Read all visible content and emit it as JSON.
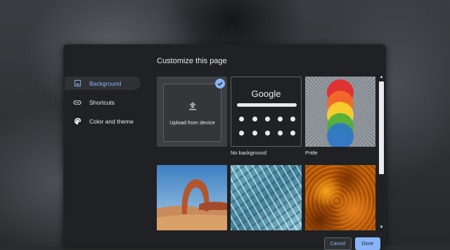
{
  "dialog": {
    "title": "Customize this page"
  },
  "nav": {
    "items": [
      {
        "label": "Background",
        "icon": "image-icon",
        "active": true
      },
      {
        "label": "Shortcuts",
        "icon": "link-icon",
        "active": false
      },
      {
        "label": "Color and theme",
        "icon": "palette-icon",
        "active": false
      }
    ]
  },
  "tiles": {
    "upload_label": "Upload from device",
    "no_background_label": "No background",
    "no_background_logo": "Google",
    "pride_label": "Pride"
  },
  "buttons": {
    "cancel": "Cancel",
    "done": "Done"
  },
  "colors": {
    "accent": "#8ab4f8",
    "dialog_bg": "#202124",
    "text": "#e8eaed"
  }
}
